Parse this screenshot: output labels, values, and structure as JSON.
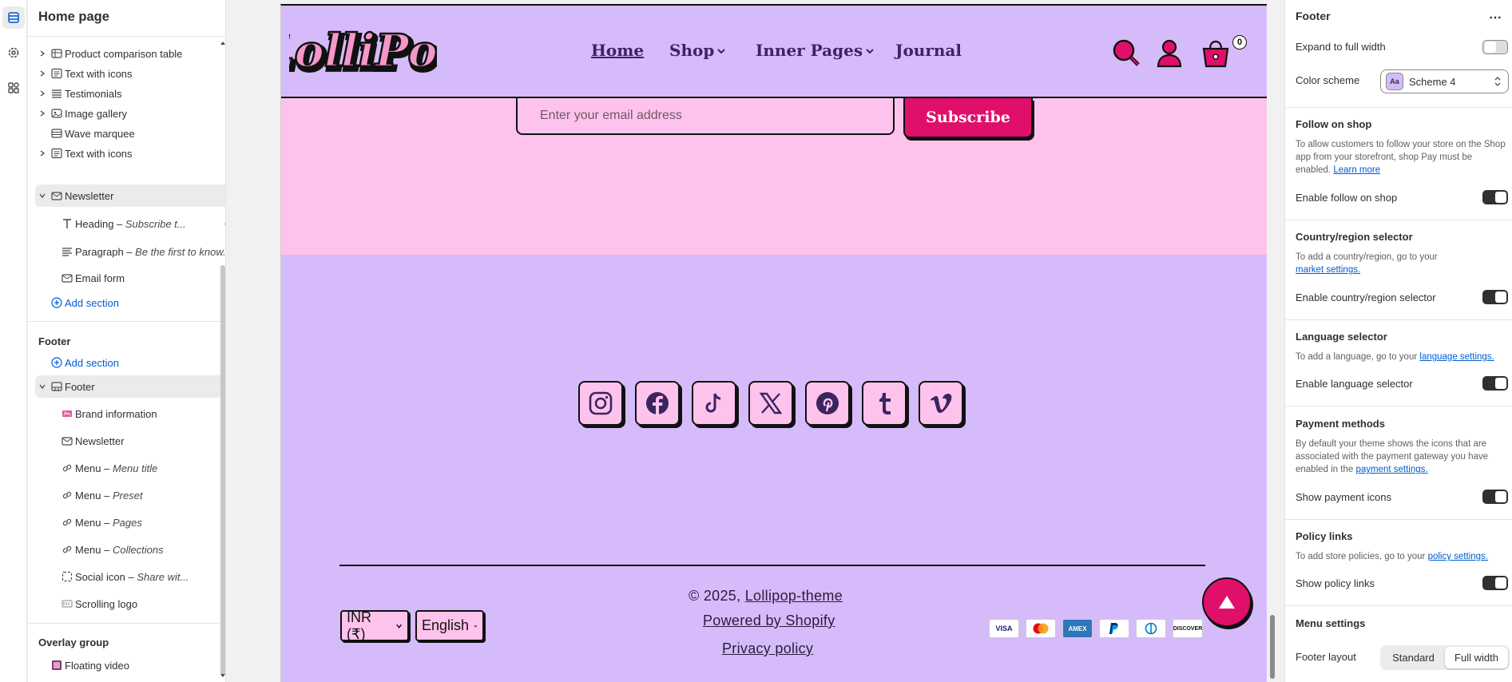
{
  "left_panel": {
    "title": "Home page",
    "rows": [
      {
        "label": "Product comparison table",
        "icon": "table-icon"
      },
      {
        "label": "Text with icons",
        "icon": "text-icons-icon"
      },
      {
        "label": "Testimonials",
        "icon": "list-icon"
      },
      {
        "label": "Image gallery",
        "icon": "image-gallery-icon"
      },
      {
        "label": "Wave marquee",
        "icon": "marquee-icon"
      },
      {
        "label": "Text with icons",
        "icon": "text-icons-icon"
      },
      {
        "label": "Newsletter",
        "icon": "mail-icon"
      }
    ],
    "newsletter_children": [
      {
        "label": "Heading – ",
        "italic": "Subscribe t..."
      },
      {
        "label": "Paragraph – ",
        "italic": "Be the first to know..."
      },
      {
        "label": "Email form",
        "italic": ""
      }
    ],
    "add_section": "Add section",
    "footer_group": "Footer",
    "footer_add_section": "Add section",
    "footer_section": "Footer",
    "footer_children": [
      {
        "label": "Brand information",
        "italic": ""
      },
      {
        "label": "Newsletter",
        "italic": ""
      },
      {
        "label": "Menu – ",
        "italic": "Menu title"
      },
      {
        "label": "Menu – ",
        "italic": "Preset"
      },
      {
        "label": "Menu – ",
        "italic": "Pages"
      },
      {
        "label": "Menu – ",
        "italic": "Collections"
      },
      {
        "label": "Social icon – ",
        "italic": "Share wit..."
      },
      {
        "label": "Scrolling logo",
        "italic": ""
      }
    ],
    "overlay_group": "Overlay group",
    "floating_video": "Floating video"
  },
  "preview": {
    "logo_text": "LolliPop",
    "nav": {
      "home": "Home",
      "shop": "Shop",
      "inner": "Inner Pages",
      "journal": "Journal"
    },
    "cart_count": "0",
    "email_placeholder": "Enter your email address",
    "subscribe": "Subscribe",
    "social": [
      "instagram-icon",
      "facebook-icon",
      "tiktok-icon",
      "x-icon",
      "pinterest-icon",
      "tumblr-icon",
      "vimeo-icon"
    ],
    "copyright_prefix": "© 2025,",
    "copyright_link": "Lollipop-theme",
    "powered": "Powered by Shopify",
    "privacy": "Privacy policy",
    "currency": "INR (₹)",
    "language": "English",
    "payments": [
      "VISA",
      "MC",
      "AMEX",
      "PP",
      "Diners",
      "DISCOVER"
    ],
    "colors": {
      "header_bg": "#d6bbfb",
      "newsletter_bg": "#fec3ec",
      "accent": "#e0106a",
      "nav_text": "#3b2560"
    }
  },
  "right_panel": {
    "title": "Footer",
    "expand_label": "Expand to full width",
    "color_scheme_label": "Color scheme",
    "color_scheme_value": "Scheme 4",
    "follow_heading": "Follow on shop",
    "follow_desc": "To allow customers to follow your store on the Shop app from your storefront, shop Pay must be enabled.",
    "follow_link": "Learn more",
    "follow_toggle": "Enable follow on shop",
    "country_heading": "Country/region selector",
    "country_desc": "To add a country/region, go to your",
    "country_link": "market settings.",
    "country_toggle": "Enable country/region selector",
    "language_heading": "Language selector",
    "language_desc": "To add a language, go to your",
    "language_link": "language settings.",
    "language_toggle": "Enable language selector",
    "payment_heading": "Payment methods",
    "payment_desc": "By default your theme shows the icons that are associated with the payment gateway you have enabled in the",
    "payment_link": "payment settings.",
    "payment_toggle": "Show payment icons",
    "policy_heading": "Policy links",
    "policy_desc": "To add store policies, go to your",
    "policy_link": "policy settings.",
    "policy_toggle": "Show policy links",
    "menu_heading": "Menu settings",
    "footer_layout_label": "Footer layout",
    "layout_options": [
      "Standard",
      "Full width"
    ],
    "layout_selected": "Full width"
  }
}
